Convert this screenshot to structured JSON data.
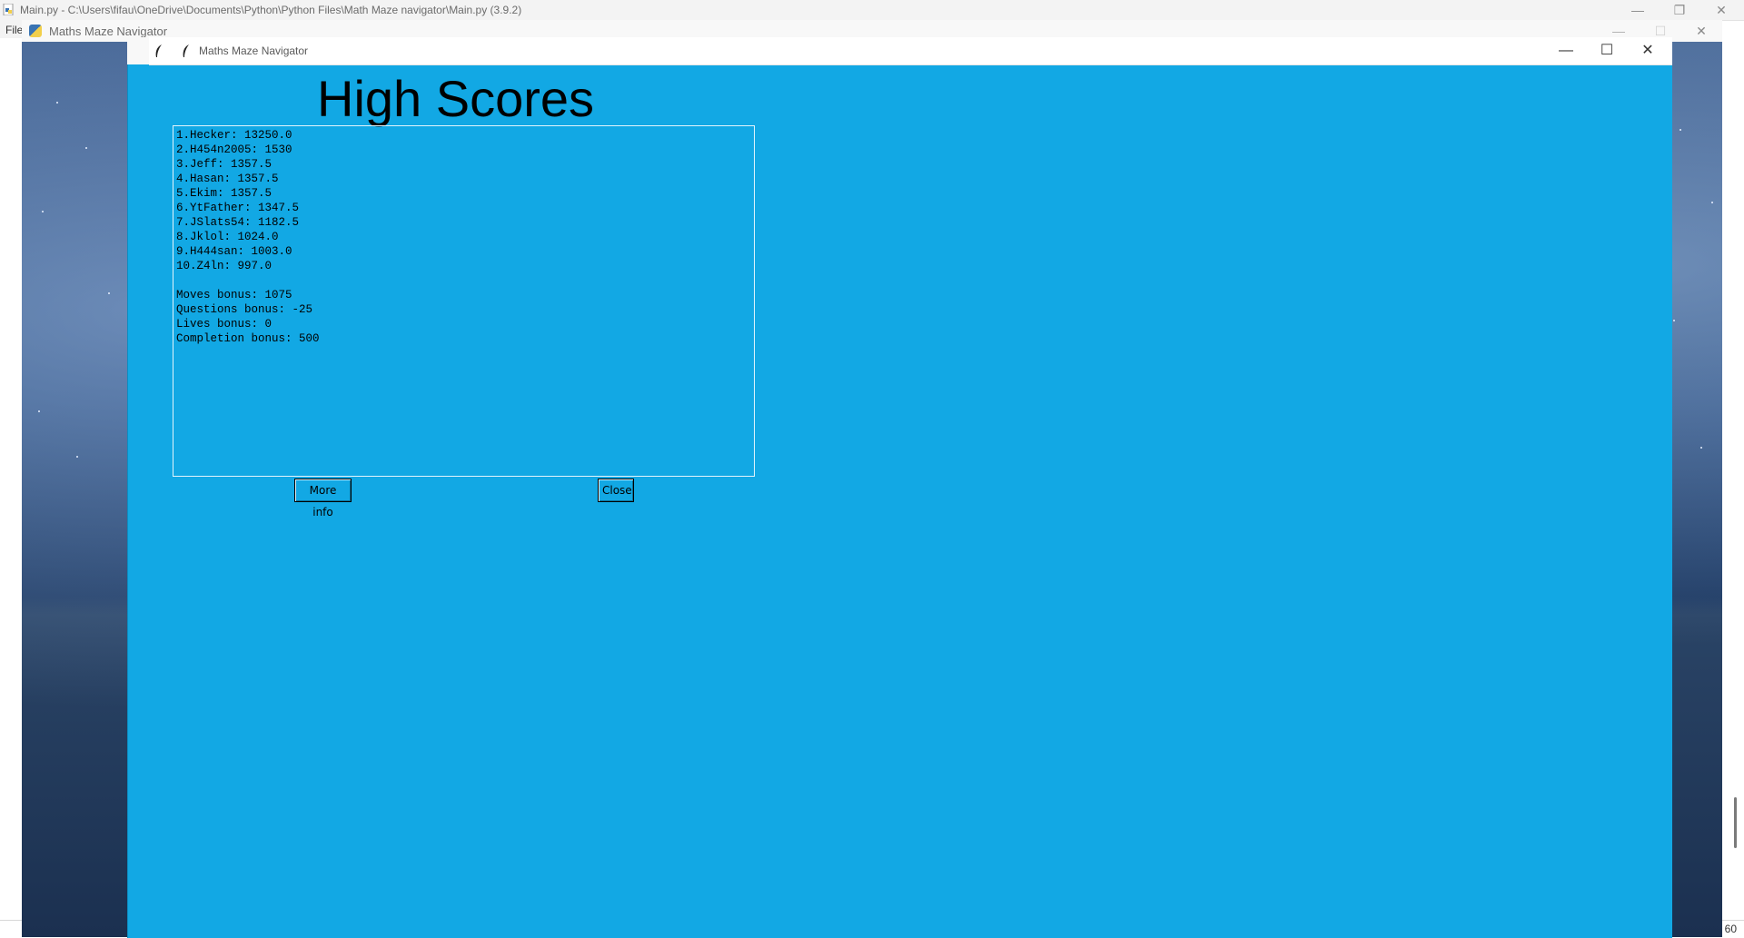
{
  "idle_window": {
    "title": "Main.py - C:\\Users\\fifau\\OneDrive\\Documents\\Python\\Python Files\\Math Maze navigator\\Main.py (3.9.2)",
    "menu_file": "File",
    "status": "; 60",
    "controls": {
      "minimize": "—",
      "restore": "❐",
      "close": "✕"
    }
  },
  "pygame_window": {
    "title": "Maths Maze Navigator",
    "controls": {
      "minimize": "—",
      "maximize": "☐",
      "close": "✕"
    }
  },
  "main_window": {
    "title": "Maths Maze Navigator",
    "controls": {
      "minimize": "—",
      "maximize": "☐",
      "close": "✕"
    },
    "bg_color": "#12a8e4"
  },
  "high_scores": {
    "heading": "High Scores",
    "entries": [
      "1.Hecker: 13250.0",
      "2.H454n2005: 1530",
      "3.Jeff: 1357.5",
      "4.Hasan: 1357.5",
      "5.Ekim: 1357.5",
      "6.YtFather: 1347.5",
      "7.JSlats54: 1182.5",
      "8.Jklol: 1024.0",
      "9.H444san: 1003.0",
      "10.Z4ln: 997.0"
    ],
    "bonuses": [
      "Moves bonus: 1075",
      "Questions bonus: -25",
      "Lives bonus: 0",
      "Completion bonus: 500"
    ],
    "more_info_label": "More info",
    "close_label": "Close"
  }
}
